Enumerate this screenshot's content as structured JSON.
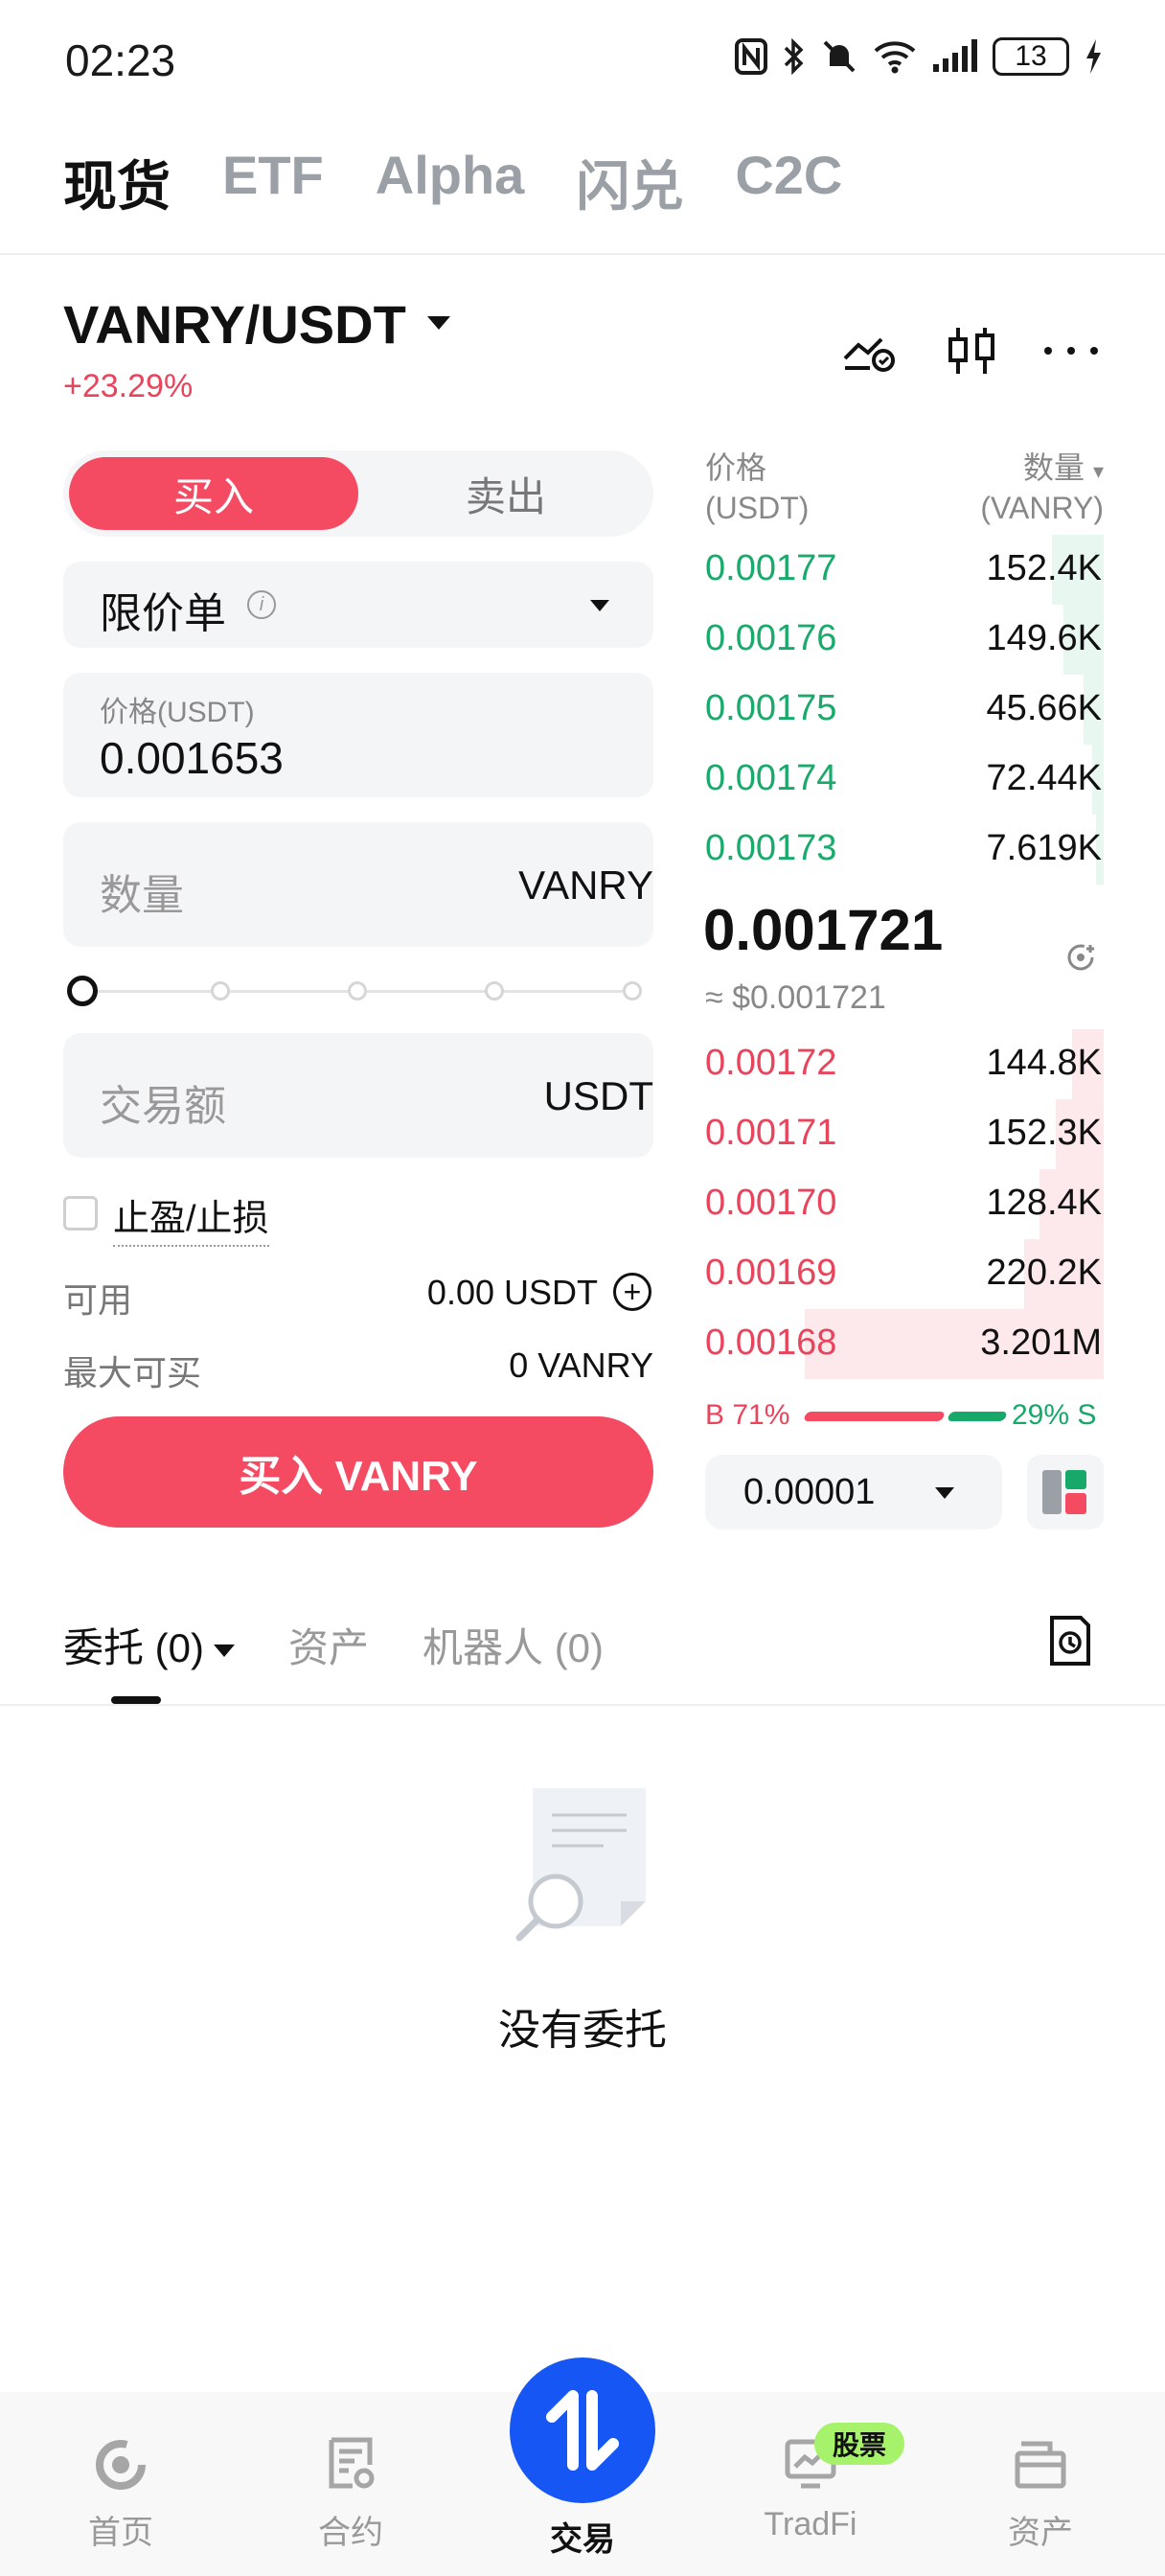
{
  "status_bar": {
    "time": "02:23",
    "battery": "13"
  },
  "top_tabs": [
    {
      "label": "现货",
      "active": true
    },
    {
      "label": "ETF",
      "active": false
    },
    {
      "label": "Alpha",
      "active": false
    },
    {
      "label": "闪兑",
      "active": false
    },
    {
      "label": "C2C",
      "active": false
    }
  ],
  "pair": {
    "name": "VANRY/USDT",
    "change": "+23.29%"
  },
  "side": {
    "buy": "买入",
    "sell": "卖出"
  },
  "order_type": {
    "label": "限价单"
  },
  "price_field": {
    "label": "价格(USDT)",
    "value": "0.001653"
  },
  "qty_field": {
    "placeholder": "数量",
    "unit": "VANRY"
  },
  "amount_field": {
    "placeholder": "交易额",
    "unit": "USDT"
  },
  "tpsl": {
    "label": "止盈/止损"
  },
  "available": {
    "label": "可用",
    "value": "0.00 USDT"
  },
  "max_buy": {
    "label": "最大可买",
    "value": "0 VANRY"
  },
  "buy_button": {
    "label": "买入 VANRY"
  },
  "orderbook": {
    "price_header": "价格",
    "price_unit": "(USDT)",
    "qty_header": "数量",
    "qty_unit": "(VANRY)",
    "asks": [
      {
        "price": "0.00177",
        "qty": "152.4K",
        "depth": 0.13
      },
      {
        "price": "0.00176",
        "qty": "149.6K",
        "depth": 0.1
      },
      {
        "price": "0.00175",
        "qty": "45.66K",
        "depth": 0.05
      },
      {
        "price": "0.00174",
        "qty": "72.44K",
        "depth": 0.03
      },
      {
        "price": "0.00173",
        "qty": "7.619K",
        "depth": 0.02
      }
    ],
    "mid_price": "0.001721",
    "mid_usd": "≈ $0.001721",
    "bids": [
      {
        "price": "0.00172",
        "qty": "144.8K",
        "depth": 0.08
      },
      {
        "price": "0.00171",
        "qty": "152.3K",
        "depth": 0.12
      },
      {
        "price": "0.00170",
        "qty": "128.4K",
        "depth": 0.16
      },
      {
        "price": "0.00169",
        "qty": "220.2K",
        "depth": 0.2
      },
      {
        "price": "0.00168",
        "qty": "3.201M",
        "depth": 0.75
      }
    ],
    "buy_ratio": "B 71%",
    "sell_ratio": "29% S",
    "tick_size": "0.00001"
  },
  "orders_tabs": [
    {
      "label": "委托 (0)",
      "active": true
    },
    {
      "label": "资产",
      "active": false
    },
    {
      "label": "机器人 (0)",
      "active": false
    }
  ],
  "empty_state": {
    "text": "没有委托"
  },
  "bottom_nav": [
    {
      "label": "首页"
    },
    {
      "label": "合约"
    },
    {
      "label": "交易"
    },
    {
      "label": "TradFi",
      "badge": "股票"
    },
    {
      "label": "资产"
    }
  ]
}
